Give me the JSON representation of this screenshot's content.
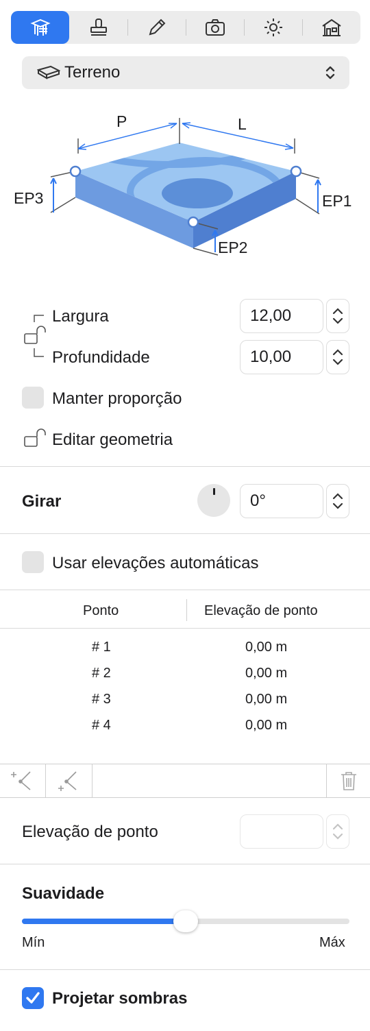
{
  "toolbar": {
    "tabs": [
      {
        "icon": "terrain-tools-icon",
        "active": true
      },
      {
        "icon": "stamp-icon",
        "active": false
      },
      {
        "icon": "pencil-icon",
        "active": false
      },
      {
        "icon": "camera-icon",
        "active": false
      },
      {
        "icon": "sun-icon",
        "active": false
      },
      {
        "icon": "house-icon",
        "active": false
      }
    ]
  },
  "object_selector": {
    "label": "Terreno",
    "icon": "terrain-icon"
  },
  "diagram": {
    "p": "P",
    "l": "L",
    "ep1": "EP1",
    "ep2": "EP2",
    "ep3": "EP3"
  },
  "dimensions": {
    "width_label": "Largura",
    "width_value": "12,00",
    "depth_label": "Profundidade",
    "depth_value": "10,00",
    "keep_ratio_label": "Manter proporção",
    "keep_ratio_checked": false,
    "edit_geometry_label": "Editar geometria"
  },
  "rotate": {
    "label": "Girar",
    "value": "0°"
  },
  "auto_elevation": {
    "label": "Usar elevações automáticas",
    "checked": false
  },
  "points_table": {
    "headers": [
      "Ponto",
      "Elevação de ponto"
    ],
    "rows": [
      [
        "# 1",
        "0,00 m"
      ],
      [
        "# 2",
        "0,00 m"
      ],
      [
        "# 3",
        "0,00 m"
      ],
      [
        "# 4",
        "0,00 m"
      ]
    ]
  },
  "point_elevation": {
    "label": "Elevação de ponto",
    "value": ""
  },
  "smoothness": {
    "label": "Suavidade",
    "min": "Mín",
    "max": "Máx",
    "level": 0.5
  },
  "shadows": {
    "label": "Projetar sombras",
    "checked": true
  },
  "colors": {
    "accent": "#2f78f0",
    "terrain_top": "#9cc6f2",
    "terrain_side": "#6d9be0"
  }
}
